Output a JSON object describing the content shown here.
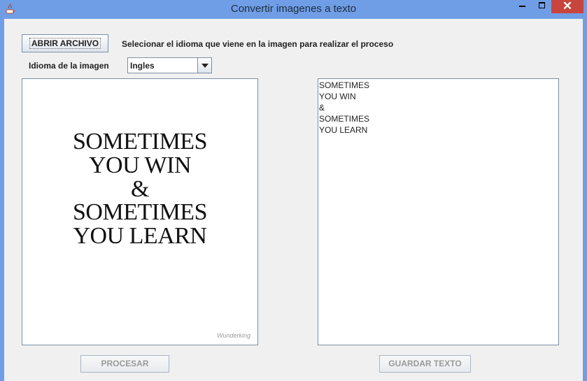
{
  "window": {
    "title": "Convertir imagenes a texto",
    "close_glyph": "✕"
  },
  "toolbar": {
    "open_button": "ABRIR ARCHIVO",
    "instruction": "Selecionar el idioma que viene en la imagen para realizar el proceso",
    "language_label": "Idioma de la imagen",
    "language_selected": "Ingles"
  },
  "image_panel": {
    "lines": [
      "SOMETIMES",
      "YOU WIN",
      "&",
      "SOMETIMES",
      "YOU LEARN"
    ],
    "watermark": "Wunderking"
  },
  "text_panel": {
    "lines": [
      "SOMETIMES",
      "YOU WIN",
      "&",
      "SOMETIMES",
      "YOU LEARN"
    ]
  },
  "actions": {
    "process_button": "PROCESAR",
    "save_button": "GUARDAR TEXTO"
  },
  "icons": {
    "app": "java-icon",
    "minimize": "minimize-icon",
    "maximize": "maximize-icon",
    "close": "close-icon"
  },
  "colors": {
    "titlebar": "#6f9ee6",
    "close": "#c7453c",
    "window_bg": "#f0f0f0"
  }
}
